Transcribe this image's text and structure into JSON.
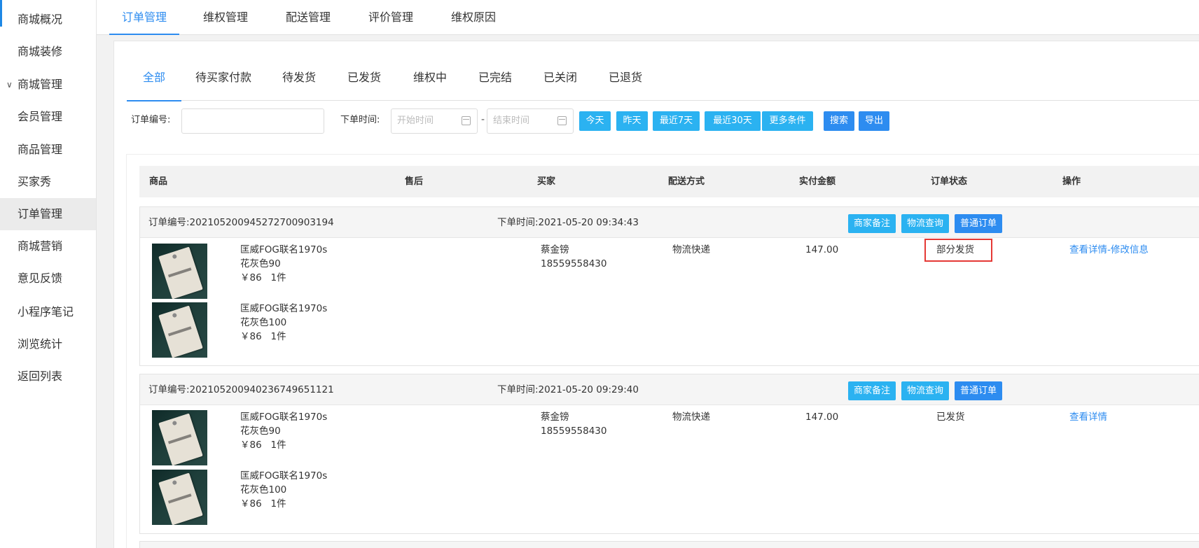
{
  "sidebar": {
    "items": [
      {
        "label": "商城概况"
      },
      {
        "label": "商城装修"
      },
      {
        "label": "商城管理"
      },
      {
        "label": "会员管理"
      },
      {
        "label": "商品管理"
      },
      {
        "label": "买家秀"
      },
      {
        "label": "订单管理"
      },
      {
        "label": "商城营销"
      },
      {
        "label": "意见反馈"
      },
      {
        "label": "小程序笔记"
      },
      {
        "label": "浏览统计"
      },
      {
        "label": "返回列表"
      }
    ],
    "active": "订单管理",
    "expanded_icon": "chevron-down-icon"
  },
  "top_tabs": [
    "订单管理",
    "维权管理",
    "配送管理",
    "评价管理",
    "维权原因"
  ],
  "sub_tabs": [
    "全部",
    "待买家付款",
    "待发货",
    "已发货",
    "维权中",
    "已完结",
    "已关闭",
    "已退货"
  ],
  "filter": {
    "order_no_label": "订单编号:",
    "order_no_value": "",
    "time_label": "下单时间:",
    "start_placeholder": "开始时间",
    "end_placeholder": "结束时间",
    "dash": "-",
    "quick": [
      "今天",
      "昨天",
      "最近7天",
      "最近30天",
      "更多条件"
    ],
    "search": "搜索",
    "export": "导出"
  },
  "table": {
    "headers": [
      "商品",
      "售后",
      "买家",
      "配送方式",
      "实付金额",
      "订单状态",
      "操作"
    ]
  },
  "orders": [
    {
      "no": "订单编号:202105200945272700903194",
      "time": "下单时间:2021-05-20 09:34:43",
      "buttons": [
        "商家备注",
        "物流查询",
        "普通订单"
      ],
      "items": [
        {
          "name": "匡威FOG联名1970s",
          "spec": "花灰色90",
          "price": "￥86   1件"
        },
        {
          "name": "匡威FOG联名1970s",
          "spec": "花灰色100",
          "price": "￥86   1件"
        }
      ],
      "buyer_name": "蔡金镑",
      "buyer_phone": "18559558430",
      "delivery": "物流快递",
      "amount": "147.00",
      "status": "部分发货",
      "actions": [
        "查看详情",
        "-修改信息"
      ]
    },
    {
      "no": "订单编号:202105200940236749651121",
      "time": "下单时间:2021-05-20 09:29:40",
      "buttons": [
        "商家备注",
        "物流查询",
        "普通订单"
      ],
      "items": [
        {
          "name": "匡威FOG联名1970s",
          "spec": "花灰色90",
          "price": "￥86   1件"
        },
        {
          "name": "匡威FOG联名1970s",
          "spec": "花灰色100",
          "price": "￥86   1件"
        }
      ],
      "buyer_name": "蔡金镑",
      "buyer_phone": "18559558430",
      "delivery": "物流快递",
      "amount": "147.00",
      "status": "已发货",
      "actions": [
        "查看详情"
      ]
    }
  ],
  "colors": {
    "accent": "#2d8cf0",
    "quick_button": "#2bb2f1",
    "highlight_border": "#e53935"
  }
}
